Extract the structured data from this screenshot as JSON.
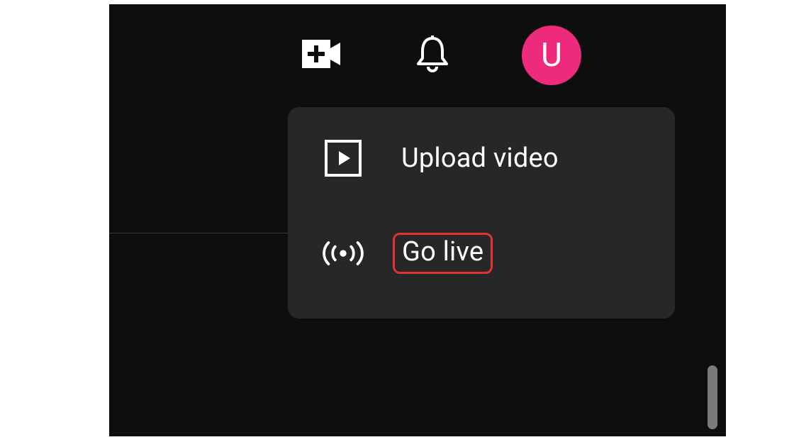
{
  "colors": {
    "accent": "#ed2a7b",
    "panel": "#272727",
    "bg": "#0e0e0e",
    "highlight": "#e33232"
  },
  "topbar": {
    "create_icon": "create-video-icon",
    "notifications_icon": "bell-icon",
    "avatar_letter": "U"
  },
  "create_menu": {
    "items": [
      {
        "icon": "play-box-icon",
        "label": "Upload video",
        "highlighted": false
      },
      {
        "icon": "live-broadcast-icon",
        "label": "Go live",
        "highlighted": true
      }
    ]
  }
}
